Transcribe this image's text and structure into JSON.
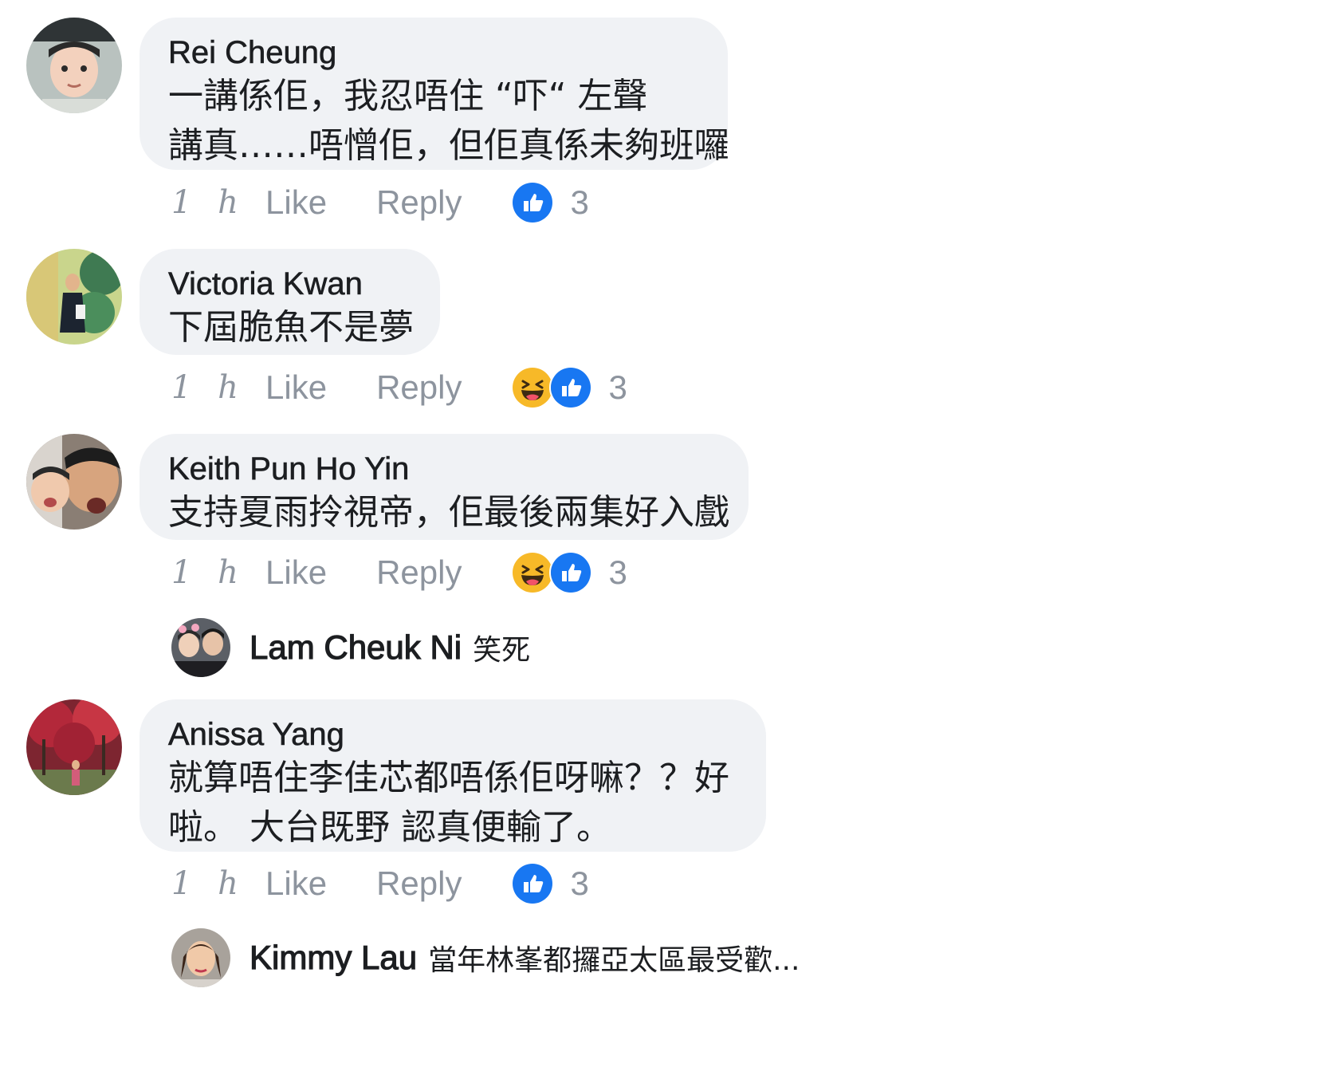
{
  "comments": [
    {
      "author": "Rei Cheung",
      "lines": [
        "一講係佢，我忍唔住 “吓“ 左聲",
        "講真……唔憎佢，但佢真係未夠班囉"
      ],
      "time": "1 h",
      "like": "Like",
      "reply": "Reply",
      "reactions": [
        "like-icon"
      ],
      "reaction_count": "3"
    },
    {
      "author": "Victoria Kwan",
      "lines": [
        "下屆脆魚不是夢"
      ],
      "time": "1 h",
      "like": "Like",
      "reply": "Reply",
      "reactions": [
        "haha-icon",
        "like-icon"
      ],
      "reaction_count": "3"
    },
    {
      "author": "Keith Pun Ho Yin",
      "lines": [
        "支持夏雨拎視帝，佢最後兩集好入戲"
      ],
      "time": "1 h",
      "like": "Like",
      "reply": "Reply",
      "reactions": [
        "haha-icon",
        "like-icon"
      ],
      "reaction_count": "3",
      "reply_preview": {
        "author": "Lam Cheuk Ni",
        "text": "笑死"
      }
    },
    {
      "author": "Anissa Yang",
      "lines": [
        "就算唔住李佳芯都唔係佢呀嘛？？好",
        "啦。 大台既野 認真便輸了。"
      ],
      "time": "1 h",
      "like": "Like",
      "reply": "Reply",
      "reactions": [
        "like-icon"
      ],
      "reaction_count": "3",
      "reply_preview": {
        "author": "Kimmy Lau",
        "text": "當年林峯都攞亞太區最受歡..."
      }
    }
  ],
  "colors": {
    "bubble": "#f0f2f5",
    "meta_text": "#8d949e",
    "like_blue": "#1877f2",
    "haha_yellow": "#f7b928"
  }
}
